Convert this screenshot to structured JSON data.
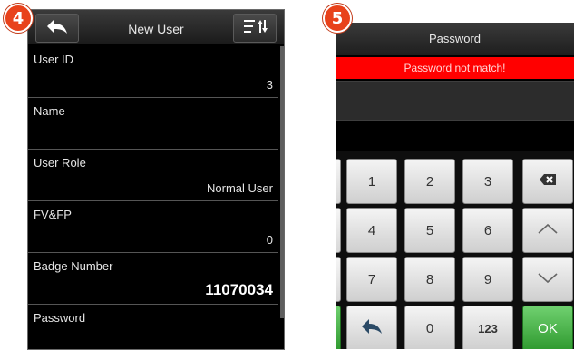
{
  "badges": {
    "left": "4",
    "right": "5"
  },
  "new_user": {
    "title": "New User",
    "back_icon": "back-arrow-icon",
    "menu_icon": "sort-menu-icon",
    "fields": [
      {
        "label": "User ID",
        "value": "3"
      },
      {
        "label": "Name",
        "value": ""
      },
      {
        "label": "User Role",
        "value": "Normal User"
      },
      {
        "label": "FV&FP",
        "value": "0"
      },
      {
        "label": "Badge Number",
        "value": "11070034"
      },
      {
        "label": "Password",
        "value": ""
      }
    ]
  },
  "password_screen": {
    "title": "Password",
    "error": "Password not match!",
    "input_value": "",
    "keys": {
      "k1": "1",
      "k2": "2",
      "k3": "3",
      "k4": "4",
      "k5": "5",
      "k6": "6",
      "k7": "7",
      "k8": "8",
      "k9": "9",
      "k0": "0",
      "mode": "123",
      "ok": "OK"
    },
    "icons": {
      "backspace": "backspace-icon",
      "up": "chevron-up-icon",
      "down": "chevron-down-icon",
      "back": "back-arrow-icon"
    },
    "colors": {
      "error_bar": "#ff0000",
      "ok_key": "#3aa53a"
    }
  }
}
